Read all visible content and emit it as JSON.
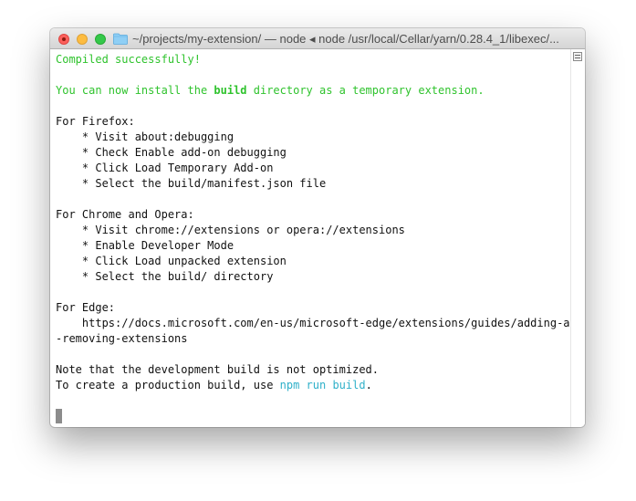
{
  "window": {
    "title": "~/projects/my-extension/ — node ◂ node /usr/local/Cellar/yarn/0.28.4_1/libexec/..."
  },
  "terminal": {
    "lines": [
      {
        "segments": [
          {
            "text": "Compiled successfully!",
            "style": "green"
          }
        ]
      },
      {
        "segments": [
          {
            "text": "",
            "style": "plain"
          }
        ]
      },
      {
        "segments": [
          {
            "text": "You can now install the ",
            "style": "green"
          },
          {
            "text": "build",
            "style": "green-bold"
          },
          {
            "text": " directory as a temporary extension.",
            "style": "green"
          }
        ]
      },
      {
        "segments": [
          {
            "text": "",
            "style": "plain"
          }
        ]
      },
      {
        "segments": [
          {
            "text": "For Firefox:",
            "style": "plain"
          }
        ]
      },
      {
        "segments": [
          {
            "text": "    * Visit about:debugging",
            "style": "plain"
          }
        ]
      },
      {
        "segments": [
          {
            "text": "    * Check Enable add-on debugging",
            "style": "plain"
          }
        ]
      },
      {
        "segments": [
          {
            "text": "    * Click Load Temporary Add-on",
            "style": "plain"
          }
        ]
      },
      {
        "segments": [
          {
            "text": "    * Select the build/manifest.json file",
            "style": "plain"
          }
        ]
      },
      {
        "segments": [
          {
            "text": "",
            "style": "plain"
          }
        ]
      },
      {
        "segments": [
          {
            "text": "For Chrome and Opera:",
            "style": "plain"
          }
        ]
      },
      {
        "segments": [
          {
            "text": "    * Visit chrome://extensions or opera://extensions",
            "style": "plain"
          }
        ]
      },
      {
        "segments": [
          {
            "text": "    * Enable Developer Mode",
            "style": "plain"
          }
        ]
      },
      {
        "segments": [
          {
            "text": "    * Click Load unpacked extension",
            "style": "plain"
          }
        ]
      },
      {
        "segments": [
          {
            "text": "    * Select the build/ directory",
            "style": "plain"
          }
        ]
      },
      {
        "segments": [
          {
            "text": "",
            "style": "plain"
          }
        ]
      },
      {
        "segments": [
          {
            "text": "For Edge:",
            "style": "plain"
          }
        ]
      },
      {
        "segments": [
          {
            "text": "    https://docs.microsoft.com/en-us/microsoft-edge/extensions/guides/adding-and",
            "style": "plain"
          }
        ]
      },
      {
        "segments": [
          {
            "text": "-removing-extensions",
            "style": "plain"
          }
        ]
      },
      {
        "segments": [
          {
            "text": "",
            "style": "plain"
          }
        ]
      },
      {
        "segments": [
          {
            "text": "Note that the development build is not optimized.",
            "style": "plain"
          }
        ]
      },
      {
        "segments": [
          {
            "text": "To create a production build, use ",
            "style": "plain"
          },
          {
            "text": "npm run build",
            "style": "cyan"
          },
          {
            "text": ".",
            "style": "plain"
          }
        ]
      },
      {
        "segments": [
          {
            "text": "",
            "style": "plain"
          }
        ]
      },
      {
        "segments": [
          {
            "text": "",
            "style": "cursor"
          }
        ]
      }
    ]
  },
  "colors": {
    "success_green": "#2fc32d",
    "command_cyan": "#2fb0c9",
    "text": "#111111"
  },
  "icons": {
    "close": "close-button-icon",
    "minimize": "minimize-button-icon",
    "maximize": "maximize-button-icon",
    "folder": "folder-icon",
    "scroll_marker": "scroll-marker-icon"
  }
}
